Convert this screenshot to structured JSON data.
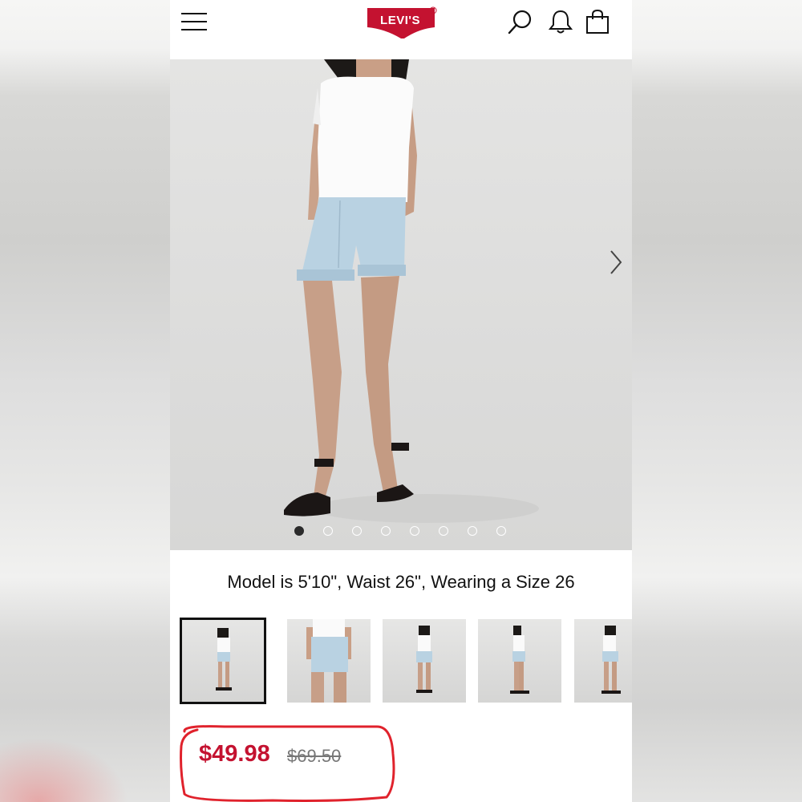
{
  "header": {
    "brand": "Levi's",
    "brand_display": "LEVI'S",
    "brand_color": "#c41230",
    "icons": [
      "menu-icon",
      "search-icon",
      "bell-icon",
      "bag-icon"
    ]
  },
  "gallery": {
    "slide_count": 8,
    "active_slide": 1,
    "next_icon": "chevron-right-icon"
  },
  "product": {
    "model_caption": "Model is 5'10\", Waist 26\", Wearing a Size 26",
    "sale_price": "$49.98",
    "original_price": "$69.50",
    "sale_color": "#c41230"
  },
  "thumbnails": {
    "count": 5,
    "selected_index": 0
  },
  "annotation": {
    "color": "#e0222c"
  }
}
